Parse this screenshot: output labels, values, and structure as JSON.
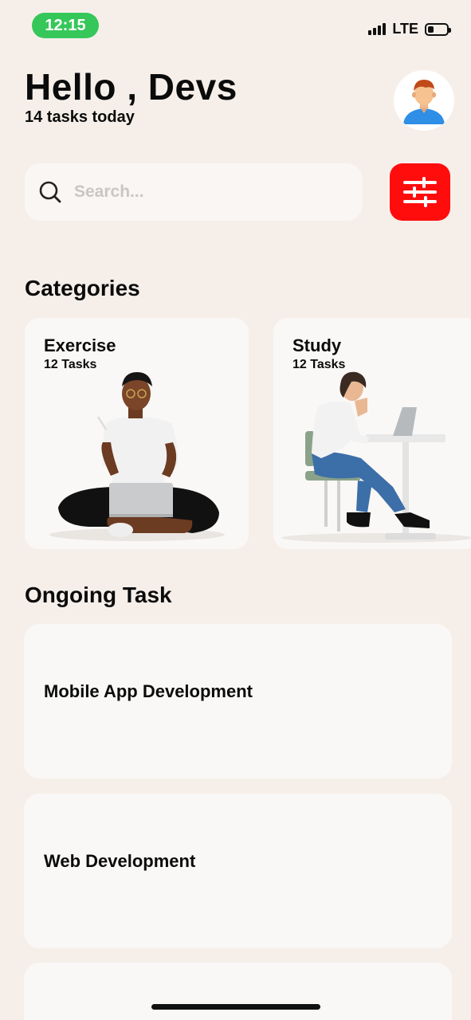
{
  "status_bar": {
    "time": "12:15",
    "network": "LTE",
    "icons": [
      "signal-icon",
      "battery-icon"
    ]
  },
  "header": {
    "greeting": "Hello , Devs",
    "subtitle": "14 tasks today",
    "avatar_icon": "user-avatar-icon"
  },
  "search": {
    "placeholder": "Search...",
    "icon": "search-icon"
  },
  "filter": {
    "icon": "sliders-icon",
    "color": "#ff0d0d"
  },
  "categories": {
    "title": "Categories",
    "items": [
      {
        "title": "Exercise",
        "count": "12 Tasks",
        "illustration": "person-with-laptop-illustration"
      },
      {
        "title": "Study",
        "count": "12 Tasks",
        "illustration": "person-at-desk-illustration"
      }
    ]
  },
  "ongoing": {
    "title": "Ongoing Task",
    "items": [
      {
        "title": "Mobile App Development"
      },
      {
        "title": "Web Development"
      },
      {
        "title": ""
      }
    ]
  },
  "colors": {
    "background": "#f6efe9",
    "card": "#faf8f6",
    "status_pill": "#35c759",
    "accent": "#ff0d0d"
  }
}
